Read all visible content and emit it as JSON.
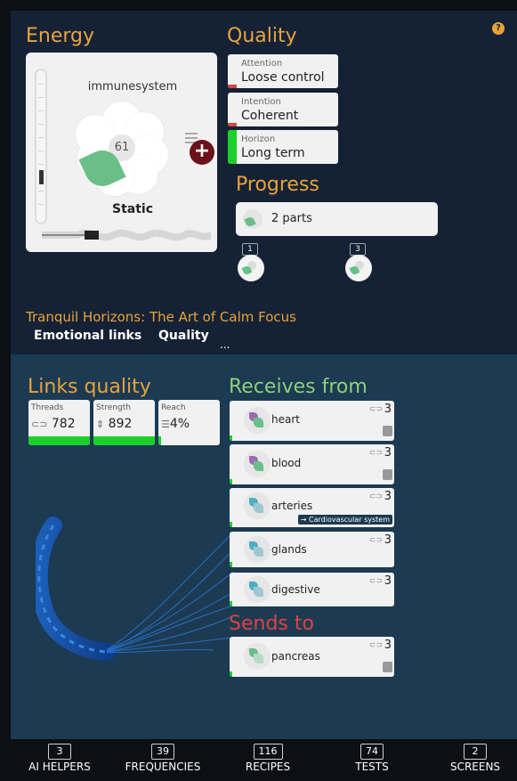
{
  "energy": {
    "title": "Energy",
    "name": "immunesystem",
    "value": "61",
    "state": "Static"
  },
  "quality": {
    "title": "Quality",
    "items": [
      {
        "label": "Attention",
        "value": "Loose control"
      },
      {
        "label": "Intention",
        "value": "Coherent"
      },
      {
        "label": "Horizon",
        "value": "Long term"
      }
    ]
  },
  "progress": {
    "title": "Progress",
    "text": "2 parts",
    "steps": [
      "1",
      "3"
    ]
  },
  "project": {
    "title": "Tranquil Horizons: The Art of Calm Focus",
    "tabs": [
      "Emotional links",
      "Quality"
    ],
    "more": "..."
  },
  "links_quality": {
    "title": "Links quality",
    "cards": [
      {
        "label": "Threads",
        "icon": "link-icon",
        "value": "782",
        "level_percent": 100
      },
      {
        "label": "Strength",
        "icon": "updown-icon",
        "value": "892",
        "level_percent": 100
      },
      {
        "label": "Reach",
        "icon": "reach-icon",
        "value": "4%",
        "level_percent": 4
      }
    ]
  },
  "receives_from": {
    "title": "Receives from",
    "items": [
      {
        "name": "heart",
        "count": "3",
        "colors": [
          "#9b6bb5",
          "#6abf88"
        ]
      },
      {
        "name": "blood",
        "count": "3",
        "colors": [
          "#9b6bb5",
          "#6abf88"
        ]
      },
      {
        "name": "arteries",
        "count": "3",
        "colors": [
          "#4bb0c4",
          "#9fc7d0"
        ],
        "tag": "→ Cardiovascular system"
      },
      {
        "name": "glands",
        "count": "3",
        "colors": [
          "#4bb0c4",
          "#9fc7d0"
        ]
      },
      {
        "name": "digestive",
        "count": "3",
        "colors": [
          "#4bb0c4",
          "#9fc7d0"
        ]
      }
    ]
  },
  "sends_to": {
    "title": "Sends to",
    "items": [
      {
        "name": "pancreas",
        "count": "3",
        "colors": [
          "#6abf88",
          "#b5dcbf"
        ]
      }
    ]
  },
  "nav": [
    {
      "count": "3",
      "label": "AI HELPERS"
    },
    {
      "count": "39",
      "label": "FREQUENCIES"
    },
    {
      "count": "116",
      "label": "RECIPES"
    },
    {
      "count": "74",
      "label": "TESTS"
    },
    {
      "count": "2",
      "label": "SCREENS"
    }
  ],
  "colors": {
    "accent_orange": "#e8a33c",
    "accent_green": "#8bd07a",
    "accent_red": "#d84545",
    "bar_green": "#1ccf2b",
    "top_panel": "#152235",
    "bottom_panel": "#1c3a52"
  }
}
